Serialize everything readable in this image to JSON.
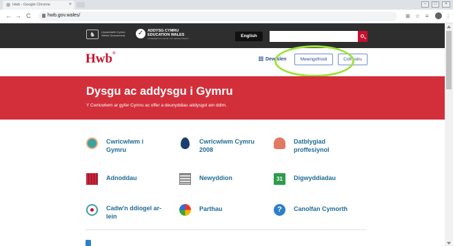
{
  "browser": {
    "tab_title": "Hwb - Google Chrome",
    "tab_close": "×",
    "url": "hwb.gov.wales/",
    "nav": {
      "back": "←",
      "forward": "→",
      "reload": "C"
    },
    "toolbar_icons": {
      "translate": "⊞",
      "star": "☆",
      "extension": "≡",
      "menu": "⋮"
    },
    "window_controls": {
      "minimize": "–",
      "maximize": "□",
      "close": "×"
    }
  },
  "site_header": {
    "gov_logo_line1": "Llywodraeth Cymru",
    "gov_logo_line2": "Welsh Government",
    "dragon_glyph": "♞",
    "ace_title_line1": "ADDYSG CYMRU",
    "ace_title_line2": "EDUCATION WALES",
    "ace_tagline": "cenhadaeth ein cenedl / our national mission",
    "check_glyph": "✓",
    "language_button": "English",
    "search_placeholder": ""
  },
  "nav": {
    "logo": "Hwb",
    "logo_mark": "®",
    "apps_link": "Dewislen",
    "login_button": "Mewngofnodi",
    "register_button": "Cofrestru"
  },
  "hero": {
    "title": "Dysgu ac addysgu i Gymru",
    "subtitle": "Y Cwricwlwm ar gyfer Cymru ac offer a deunyddiau addysgol am ddim."
  },
  "links": {
    "curriculum_wales": "Cwricwlwm i Gymru",
    "curriculum_2008": "Cwricwlwm Cymru 2008",
    "professional_dev": "Datblygiad proffesiynol",
    "resources": "Adnoddau",
    "news": "Newyddion",
    "events": "Digwyddiadau",
    "online_safety": "Cadw'n ddiogel ar-lein",
    "zones": "Parthau",
    "help_centre": "Canolfan Cymorth"
  },
  "icons": {
    "calendar_day": "31",
    "help_mark": "?"
  },
  "colors": {
    "brand_red": "#c8102e",
    "hero_red": "#d32f3a",
    "link_blue": "#1f6c94",
    "dark_header": "#2e2e2e",
    "highlight_green": "#9be33a"
  }
}
